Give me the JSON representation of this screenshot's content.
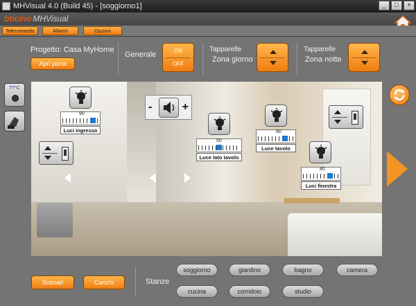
{
  "window": {
    "title": "MHVisual 4.0 (Build 45) - [soggiorno1]",
    "controls": [
      "_",
      "□",
      "×"
    ]
  },
  "brand": {
    "logo": "bticino",
    "product": "MHVisual"
  },
  "menu": {
    "tabs": [
      {
        "label": "Telecomando"
      },
      {
        "label": "Allarmi"
      },
      {
        "label": "Opzioni"
      }
    ]
  },
  "project": {
    "label": "Progetto: Casa MyHome",
    "open_door_label": "Apri porta"
  },
  "generale": {
    "label": "Generale",
    "on_label": "ON",
    "off_label": "OFF"
  },
  "tapparelle_giorno": {
    "title": "Tapparelle",
    "subtitle": "Zona giorno"
  },
  "tapparelle_notte": {
    "title": "Tapparelle",
    "subtitle": "Zona notte"
  },
  "side": {
    "temp_label": "??°C"
  },
  "scene": {
    "lights": [
      {
        "label": "Luci ingresso",
        "value": 90,
        "level": 0.9
      },
      {
        "label": "Luce lato tavolo",
        "value": 50,
        "level": 0.5
      },
      {
        "label": "Luce tavolo",
        "value": 80,
        "level": 0.8
      },
      {
        "label": "Luci finestra",
        "value": 80,
        "level": 0.8
      }
    ],
    "volume": {
      "minus": "-",
      "plus": "+"
    }
  },
  "bottom": {
    "scenari_label": "Scenari",
    "carichi_label": "Carichi",
    "stanze_label": "Stanze"
  },
  "rooms": [
    {
      "label": "soggiorno"
    },
    {
      "label": "giardino"
    },
    {
      "label": "bagno"
    },
    {
      "label": "camera"
    },
    {
      "label": "cucina"
    },
    {
      "label": "corridoio"
    },
    {
      "label": "studio"
    }
  ],
  "colors": {
    "accent": "#f39324",
    "panel": "#747474",
    "slider_knob": "#1e78d0"
  }
}
